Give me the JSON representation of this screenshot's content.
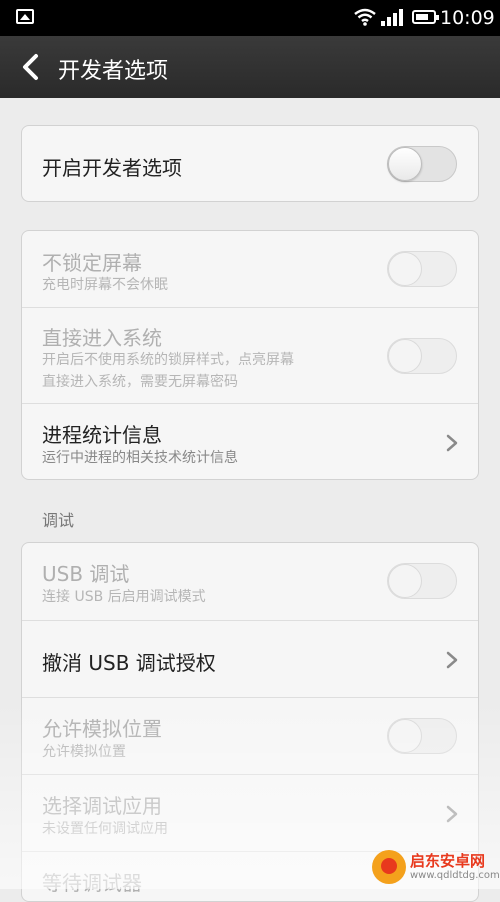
{
  "status_bar": {
    "time": "10:09",
    "icons": [
      "gallery-icon",
      "wifi-icon",
      "signal-icon",
      "battery-icon"
    ]
  },
  "action_bar": {
    "title": "开发者选项",
    "back_icon": "chevron-left-icon"
  },
  "main_toggle": {
    "label": "开启开发者选项",
    "state": "off"
  },
  "group1": [
    {
      "title": "不锁定屏幕",
      "subtitle": "充电时屏幕不会休眠",
      "control": "switch",
      "disabled": true
    },
    {
      "title": "直接进入系统",
      "subtitle_line1": "开启后不使用系统的锁屏样式，点亮屏幕",
      "subtitle_line2": "直接进入系统，需要无屏幕密码",
      "control": "switch",
      "disabled": true
    },
    {
      "title": "进程统计信息",
      "subtitle": "运行中进程的相关技术统计信息",
      "control": "chevron",
      "disabled": false
    }
  ],
  "section_debug": {
    "label": "调试"
  },
  "group2": [
    {
      "title": "USB 调试",
      "subtitle": "连接 USB 后启用调试模式",
      "control": "switch",
      "disabled": true
    },
    {
      "title": "撤消 USB 调试授权",
      "control": "chevron",
      "disabled": false
    },
    {
      "title": "允许模拟位置",
      "subtitle": "允许模拟位置",
      "control": "switch",
      "disabled": true
    },
    {
      "title": "选择调试应用",
      "subtitle": "未设置任何调试应用",
      "control": "chevron",
      "disabled": true
    },
    {
      "title": "等待调试器",
      "disabled": true
    }
  ],
  "watermark": {
    "line1": "启东安卓网",
    "line2": "www.qdldtdg.com"
  },
  "colors": {
    "background": "#ececec",
    "action_bar": "#2f2f2f",
    "card": "#f6f6f6",
    "title_text": "#222222",
    "disabled_text": "#b0b0b0"
  }
}
